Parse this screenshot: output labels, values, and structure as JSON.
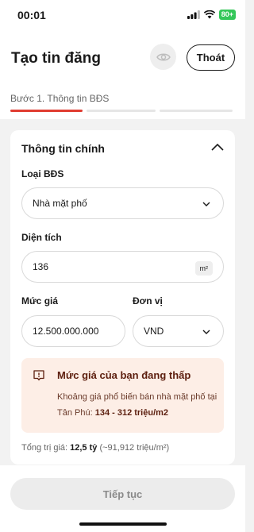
{
  "status_bar": {
    "time": "00:01",
    "battery": "80+"
  },
  "header": {
    "title": "Tạo tin đăng",
    "exit_label": "Thoát",
    "step_label": "Bước 1. Thông tin BĐS"
  },
  "progress": {
    "current_step": 1,
    "total_steps": 3,
    "active_color": "#e03c31",
    "inactive_color": "#e6e6e6"
  },
  "section": {
    "title": "Thông tin chính",
    "property_type": {
      "label": "Loại BĐS",
      "value": "Nhà mặt phố"
    },
    "area": {
      "label": "Diện tích",
      "value": "136",
      "unit": "m²"
    },
    "price": {
      "label": "Mức giá",
      "value": "12.500.000.000"
    },
    "currency": {
      "label": "Đơn vị",
      "value": "VND"
    }
  },
  "alert": {
    "title": "Mức giá của bạn đang thấp",
    "body_prefix": "Khoảng giá phổ biến bán nhà mặt phố tại Tân Phú: ",
    "range": "134 - 312 triệu/m2"
  },
  "total": {
    "label": "Tổng trị giá: ",
    "value": "12,5 tỷ",
    "detail": " (~91,912 triệu/m²)"
  },
  "footer": {
    "continue_label": "Tiếp tục"
  }
}
